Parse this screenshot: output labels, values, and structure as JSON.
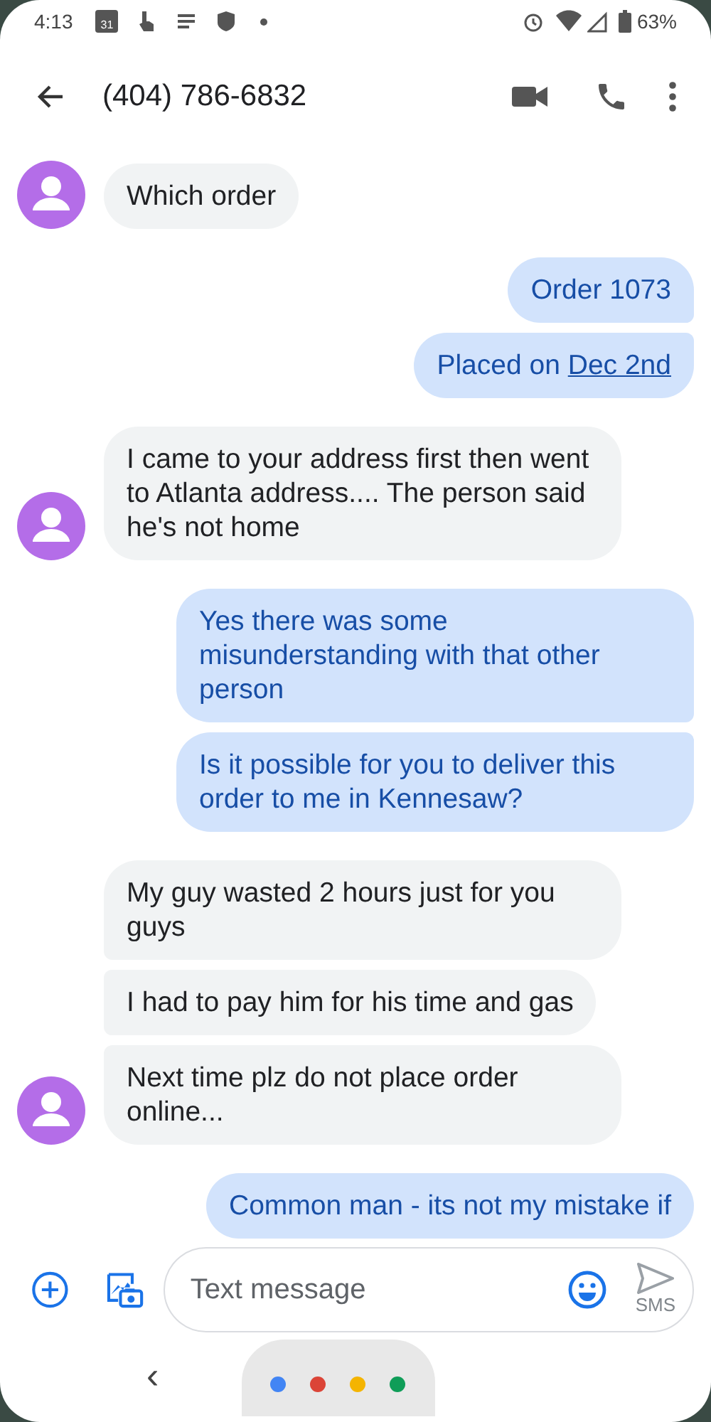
{
  "status_bar": {
    "time": "4:13",
    "calendar_day": "31",
    "battery": "63%"
  },
  "header": {
    "title": "(404) 786-6832"
  },
  "messages": [
    {
      "kind": "incoming",
      "avatar": true,
      "parts": [
        {
          "kind": "text",
          "text": "Which order"
        }
      ]
    },
    {
      "kind": "outgoing",
      "parts": [
        {
          "kind": "text",
          "text": "Order 1073"
        }
      ]
    },
    {
      "kind": "outgoing",
      "parts": [
        {
          "kind": "text",
          "text": "Placed on "
        },
        {
          "kind": "link",
          "text": "Dec 2nd"
        }
      ]
    },
    {
      "kind": "incoming",
      "avatar": true,
      "parts": [
        {
          "kind": "text",
          "text": "I came to your address first then went to Atlanta address.... The person said he's not home"
        }
      ]
    },
    {
      "kind": "outgoing",
      "parts": [
        {
          "kind": "text",
          "text": "Yes there was some misunderstanding with that other person"
        }
      ]
    },
    {
      "kind": "outgoing",
      "parts": [
        {
          "kind": "text",
          "text": "Is it possible for you to deliver this order to me in Kennesaw?"
        }
      ]
    },
    {
      "kind": "incoming",
      "avatar": false,
      "parts": [
        {
          "kind": "text",
          "text": "My guy wasted 2 hours just for you guys"
        }
      ]
    },
    {
      "kind": "incoming",
      "avatar": false,
      "parts": [
        {
          "kind": "text",
          "text": "I had to pay him for his time and gas"
        }
      ]
    },
    {
      "kind": "incoming",
      "avatar": true,
      "parts": [
        {
          "kind": "text",
          "text": "Next time plz do not place order online..."
        }
      ]
    },
    {
      "kind": "outgoing",
      "parts": [
        {
          "kind": "text",
          "text": "Common man - its not my mistake if"
        }
      ]
    }
  ],
  "composer": {
    "placeholder": "Text message",
    "send_label": "SMS"
  },
  "nav_bar": {
    "back": "‹",
    "assistant_dots": [
      {
        "color": "#4285f4"
      },
      {
        "color": "#db4437"
      },
      {
        "color": "#f4b400"
      },
      {
        "color": "#0f9d58"
      }
    ]
  }
}
